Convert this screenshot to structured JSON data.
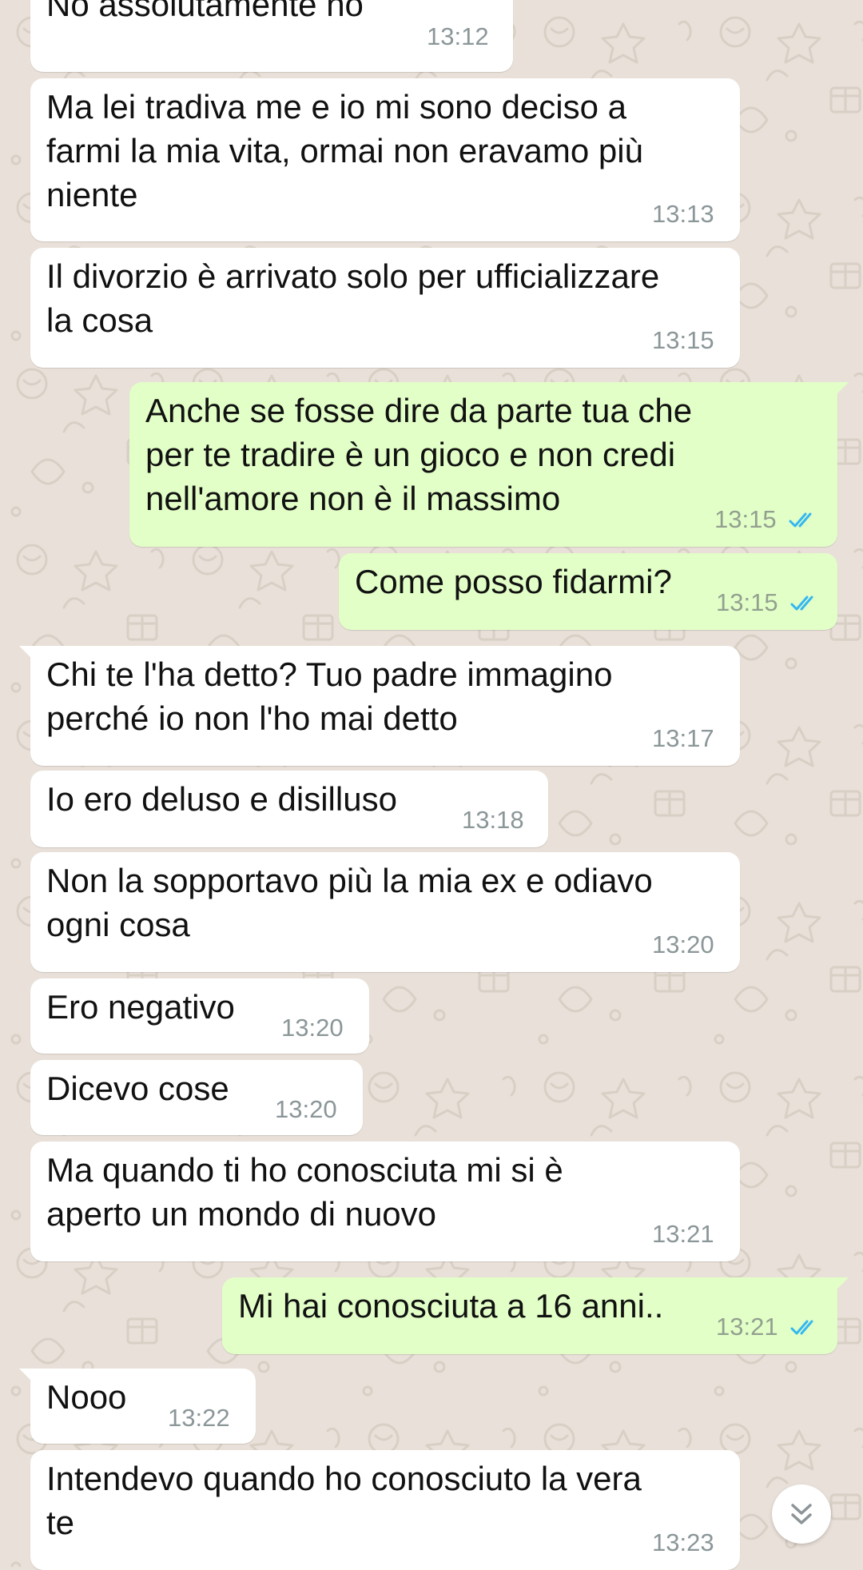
{
  "messages": [
    {
      "direction": "in",
      "text": "No assolutamente no",
      "time": "13:12"
    },
    {
      "direction": "in",
      "text": "Ma lei tradiva me e io mi sono deciso a\nfarmi la mia vita, ormai non eravamo più\nniente",
      "time": "13:13"
    },
    {
      "direction": "in",
      "text": "Il divorzio è arrivato solo per ufficializzare\nla cosa",
      "time": "13:15"
    },
    {
      "direction": "out",
      "text": "Anche se fosse dire da parte tua che\nper te tradire è un gioco e non credi\nnell'amore non è il massimo",
      "time": "13:15",
      "status": "read"
    },
    {
      "direction": "out",
      "text": "Come posso fidarmi?",
      "time": "13:15",
      "status": "read"
    },
    {
      "direction": "in",
      "text": "Chi te l'ha detto? Tuo padre immagino\nperché io non l'ho mai detto",
      "time": "13:17"
    },
    {
      "direction": "in",
      "text": "Io ero deluso e disilluso",
      "time": "13:18"
    },
    {
      "direction": "in",
      "text": "Non la sopportavo più la mia ex e odiavo\nogni cosa",
      "time": "13:20"
    },
    {
      "direction": "in",
      "text": "Ero negativo",
      "time": "13:20"
    },
    {
      "direction": "in",
      "text": "Dicevo cose",
      "time": "13:20"
    },
    {
      "direction": "in",
      "text": "Ma quando ti ho conosciuta mi si è\naperto un mondo di nuovo",
      "time": "13:21"
    },
    {
      "direction": "out",
      "text": "Mi hai conosciuta a 16 anni..",
      "time": "13:21",
      "status": "read"
    },
    {
      "direction": "in",
      "text": "Nooo",
      "time": "13:22"
    },
    {
      "direction": "in",
      "text": "Intendevo quando ho conosciuto la vera\nte",
      "time": "13:23"
    }
  ],
  "scroll_button": {
    "icon": "double-chevron-down-icon"
  },
  "colors": {
    "wallpaper": "#e9e1d9",
    "incoming_bubble": "#ffffff",
    "outgoing_bubble": "#e2ffc7",
    "read_ticks": "#34b7f1",
    "timestamp": "#8b9698"
  }
}
